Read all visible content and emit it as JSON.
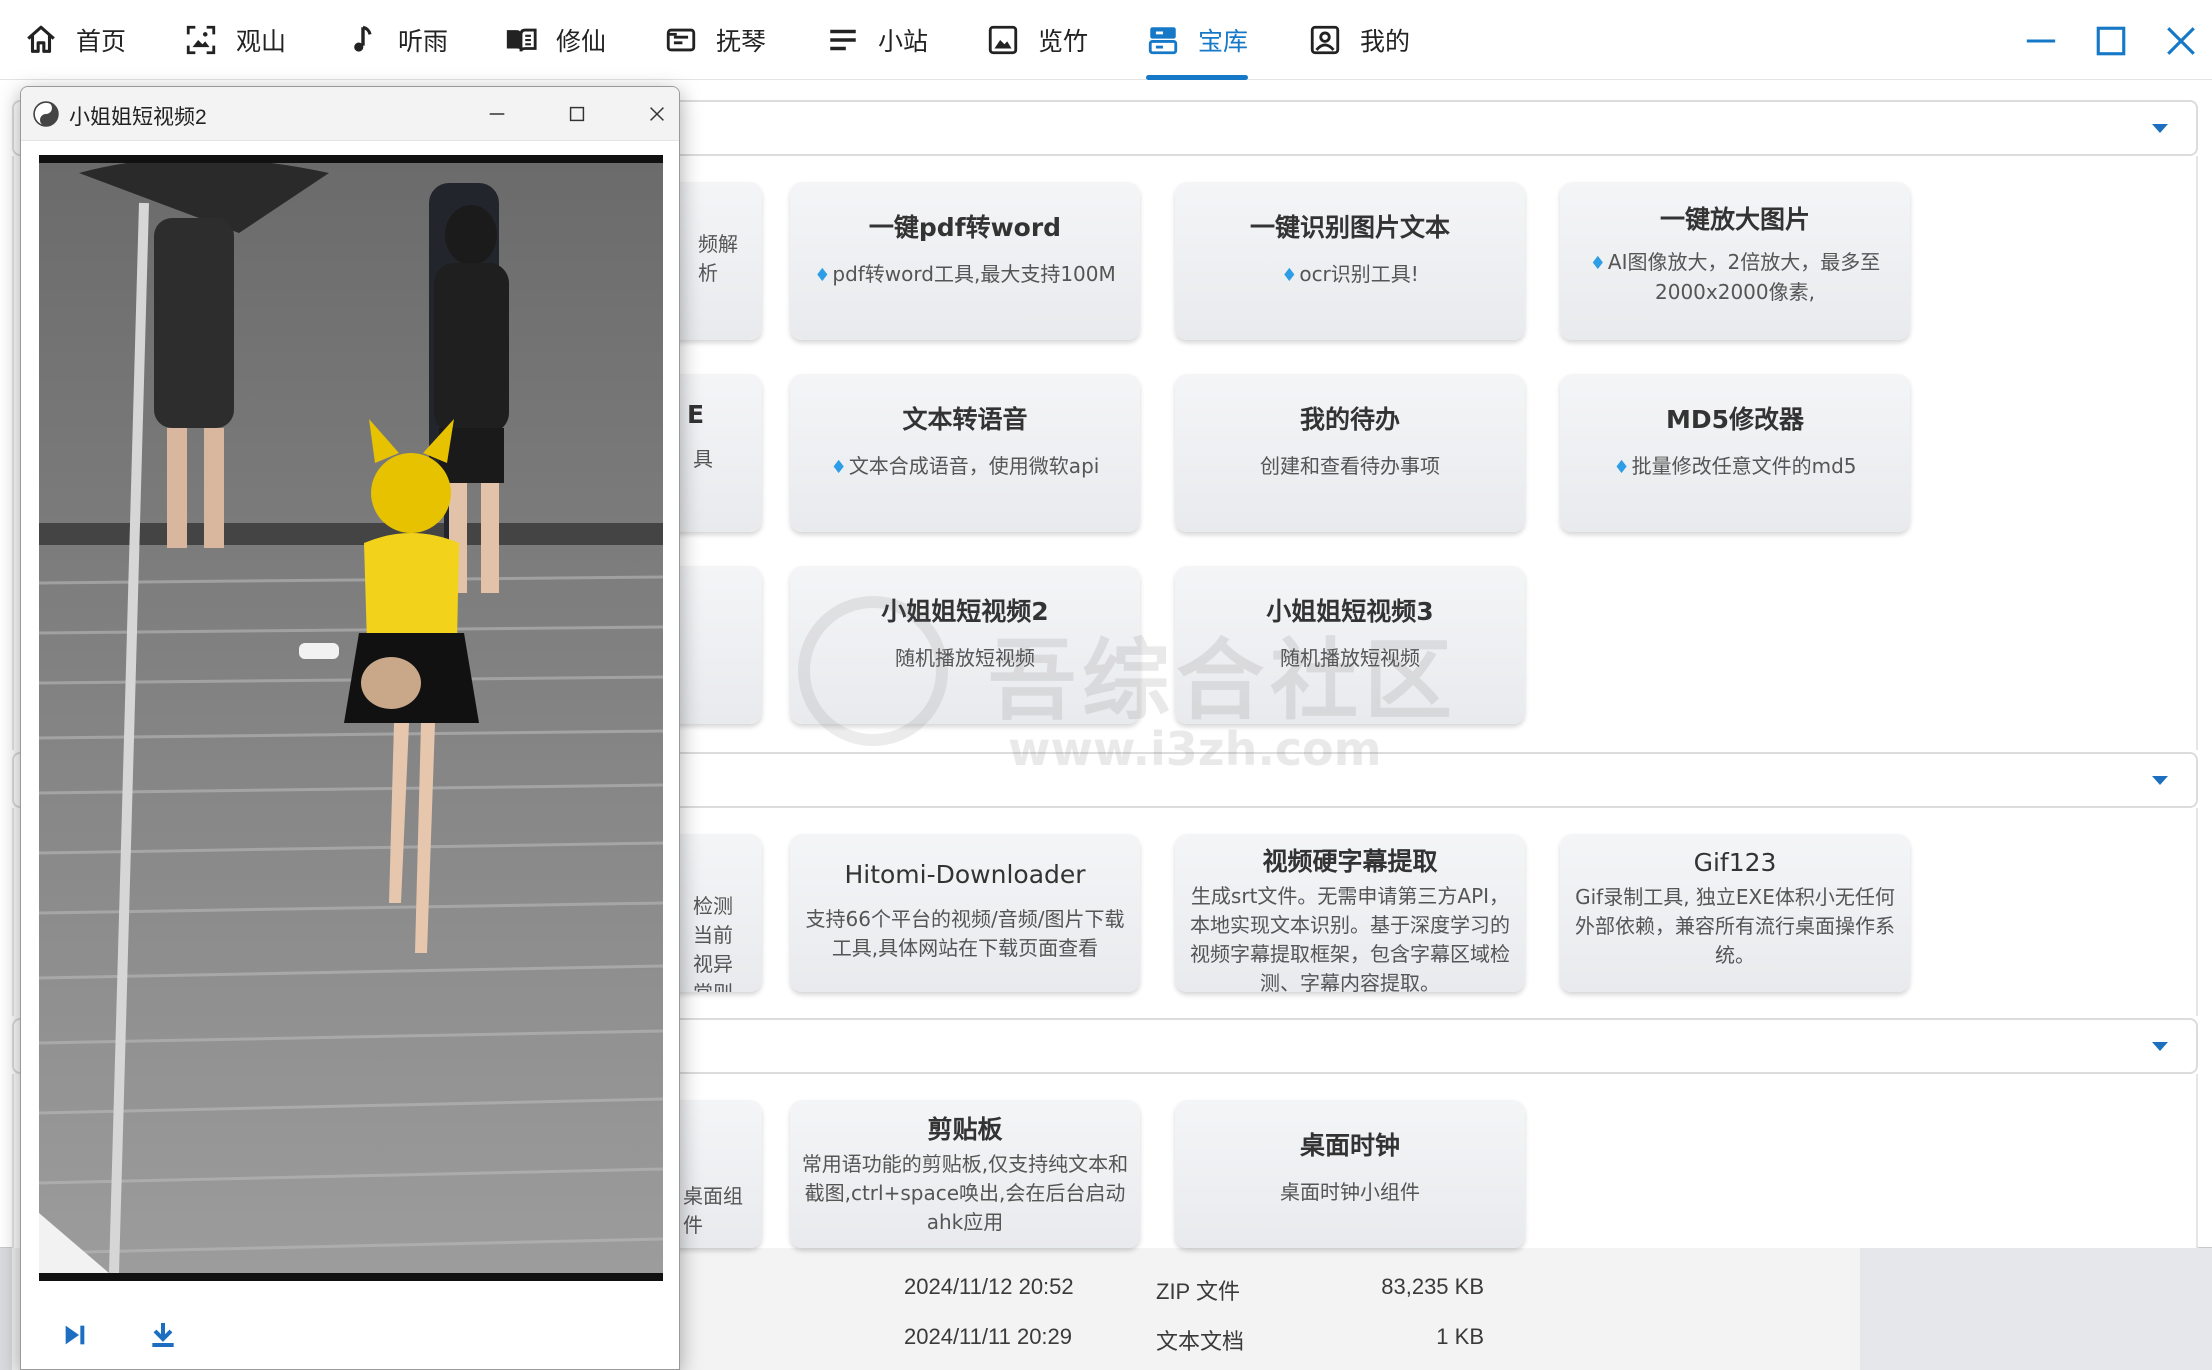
{
  "nav": {
    "items": [
      {
        "label": "首页",
        "icon": "home-icon"
      },
      {
        "label": "观山",
        "icon": "image-frame-icon"
      },
      {
        "label": "听雨",
        "icon": "music-note-icon"
      },
      {
        "label": "修仙",
        "icon": "book-icon"
      },
      {
        "label": "抚琴",
        "icon": "inbox-icon"
      },
      {
        "label": "小站",
        "icon": "lines-icon"
      },
      {
        "label": "览竹",
        "icon": "picture-icon"
      },
      {
        "label": "宝库",
        "icon": "treasure-icon",
        "active": true
      },
      {
        "label": "我的",
        "icon": "user-card-icon"
      }
    ],
    "accent_color": "#1679c8"
  },
  "window_controls": [
    "minimize-icon",
    "maximize-icon",
    "close-icon"
  ],
  "section1": {
    "cards": [
      {
        "title": "",
        "desc": "频解析"
      },
      {
        "title": "一键pdf转word",
        "desc": "pdf转word工具,最大支持100M",
        "gem": true
      },
      {
        "title": "一键识别图片文本",
        "desc": "ocr识别工具!",
        "gem": true
      },
      {
        "title": "一键放大图片",
        "desc": "AI图像放大，2倍放大，最多至2000x2000像素,",
        "gem": true
      },
      {
        "title": "E",
        "desc": "具"
      },
      {
        "title": "文本转语音",
        "desc": "文本合成语音，使用微软api",
        "gem": true
      },
      {
        "title": "我的待办",
        "desc": "创建和查看待办事项"
      },
      {
        "title": "MD5修改器",
        "desc": "批量修改任意文件的md5",
        "gem": true
      },
      {
        "title": "",
        "desc": ""
      },
      {
        "title": "小姐姐短视频2",
        "desc": "随机播放短视频"
      },
      {
        "title": "小姐姐短视频3",
        "desc": "随机播放短视频"
      }
    ]
  },
  "section2": {
    "cards": [
      {
        "title": "",
        "desc": "检测当前 视异常则"
      },
      {
        "title": "Hitomi-Downloader",
        "desc": "支持66个平台的视频/音频/图片下载工具,具体网站在下载页面查看"
      },
      {
        "title": "视频硬字幕提取",
        "desc": "生成srt文件。无需申请第三方API，本地实现文本识别。基于深度学习的视频字幕提取框架，包含字幕区域检测、字幕内容提取。"
      },
      {
        "title": "Gif123",
        "desc": "Gif录制工具, 独立EXE体积小无任何外部依赖，兼容所有流行桌面操作系统。"
      }
    ]
  },
  "section3": {
    "cards": [
      {
        "title": "",
        "desc": "桌面组件"
      },
      {
        "title": "剪贴板",
        "desc": "常用语功能的剪贴板,仅支持纯文本和截图,ctrl+space唤出,会在后台启动ahk应用"
      },
      {
        "title": "桌面时钟",
        "desc": "桌面时钟小组件"
      }
    ]
  },
  "watermark": {
    "line1": "吾综合社区",
    "line2": "www.i3zh.com"
  },
  "video_window": {
    "title": "小姐姐短视频2",
    "controls": [
      "next-track-icon",
      "download-icon"
    ]
  },
  "files": [
    {
      "date": "2024/11/12 20:52",
      "type": "ZIP 文件",
      "size": "83,235 KB"
    },
    {
      "date": "2024/11/11 20:29",
      "type": "文本文档",
      "size": "1 KB"
    }
  ]
}
